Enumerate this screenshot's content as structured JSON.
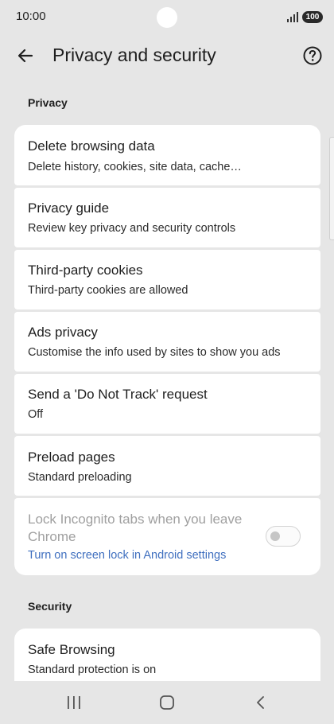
{
  "status_bar": {
    "time": "10:00",
    "battery": "100"
  },
  "header": {
    "title": "Privacy and security"
  },
  "sections": {
    "privacy": "Privacy",
    "security": "Security"
  },
  "items": {
    "delete_browsing_data": {
      "title": "Delete browsing data",
      "summary": "Delete history, cookies, site data, cache…"
    },
    "privacy_guide": {
      "title": "Privacy guide",
      "summary": "Review key privacy and security controls"
    },
    "third_party_cookies": {
      "title": "Third-party cookies",
      "summary": "Third-party cookies are allowed"
    },
    "ads_privacy": {
      "title": "Ads privacy",
      "summary": "Customise the info used by sites to show you ads"
    },
    "do_not_track": {
      "title": "Send a 'Do Not Track' request",
      "summary": "Off"
    },
    "preload_pages": {
      "title": "Preload pages",
      "summary": "Standard preloading"
    },
    "lock_incognito": {
      "title": "Lock Incognito tabs when you leave Chrome",
      "summary": "Turn on screen lock in Android settings",
      "enabled": false,
      "checked": false
    },
    "safe_browsing": {
      "title": "Safe Browsing",
      "summary": "Standard protection is on"
    }
  },
  "icons": {
    "back": "arrow-back-icon",
    "help": "help-circle-icon",
    "nav_recents": "recents-icon",
    "nav_home": "home-icon",
    "nav_back": "chevron-left-icon"
  },
  "colors": {
    "background": "#e6e6e6",
    "card": "#ffffff",
    "link": "#3f6fbf",
    "disabled_text": "#a0a0a0"
  }
}
